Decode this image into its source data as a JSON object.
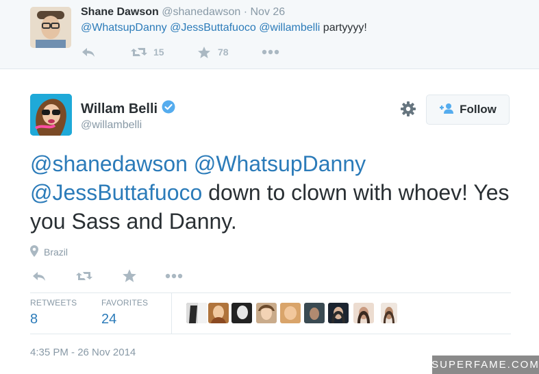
{
  "parent_tweet": {
    "name": "Shane Dawson",
    "handle": "@shanedawson",
    "separator": "·",
    "time": "Nov 26",
    "mentions": [
      "@WhatsupDanny",
      "@JessButtafuoco",
      "@willambelli"
    ],
    "text_after": "partyyyy!",
    "retweet_count": "15",
    "favorite_count": "78"
  },
  "main_tweet": {
    "name": "Willam Belli",
    "handle": "@willambelli",
    "follow_label": "Follow",
    "mentions": [
      "@shanedawson",
      "@WhatsupDanny",
      "@JessButtafuoco"
    ],
    "text_after": "down to clown with whoev! Yes you Sass and Danny.",
    "location": "Brazil",
    "stats": {
      "retweets_label": "RETWEETS",
      "retweets_value": "8",
      "favorites_label": "FAVORITES",
      "favorites_value": "24"
    },
    "timestamp": "4:35 PM - 26 Nov 2014"
  },
  "watermark": "SUPERFAME.COM",
  "colors": {
    "link": "#2b7bb9",
    "muted": "#8899a6",
    "icon": "#aab8c2",
    "verified": "#55acee"
  },
  "icons": [
    "reply-icon",
    "retweet-icon",
    "favorite-icon",
    "more-icon",
    "gear-icon",
    "follow-user-icon",
    "verified-icon",
    "location-pin-icon"
  ]
}
